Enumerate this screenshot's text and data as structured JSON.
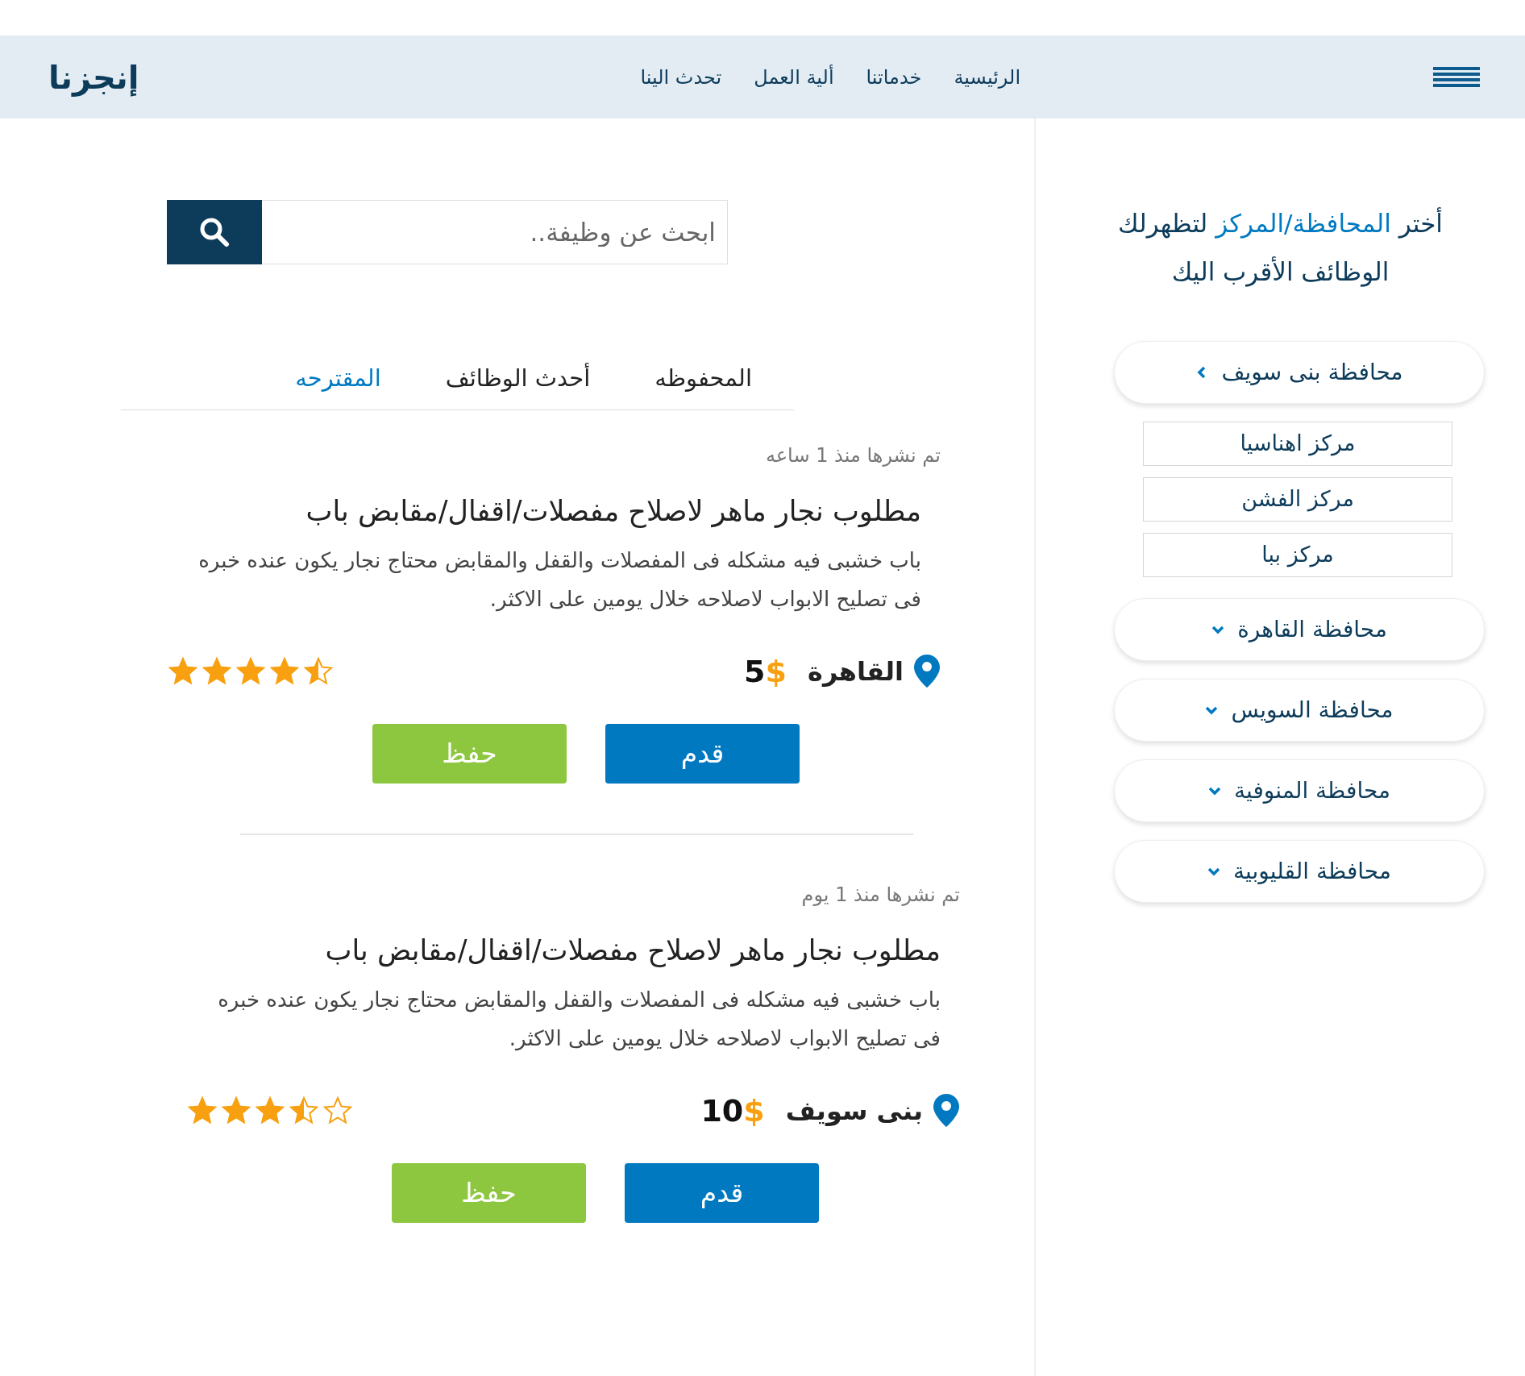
{
  "header": {
    "logo": "إنجزنا",
    "nav": [
      {
        "label": "الرئيسية"
      },
      {
        "label": "خدماتنا"
      },
      {
        "label": "ألية العمل"
      },
      {
        "label": "تحدث الينا"
      }
    ]
  },
  "sidebar": {
    "title": {
      "before": "أختر",
      "highlight": "المحافظة/المركز",
      "after": "لتظهرلك الوظائف الأقرب اليك"
    },
    "governorates": [
      {
        "label": "محافظة بنى سويف",
        "expanded": true,
        "children": [
          {
            "label": "مركز اهناسيا"
          },
          {
            "label": "مركز الفشن"
          },
          {
            "label": "مركز ببا"
          }
        ]
      },
      {
        "label": "محافظة القاهرة",
        "expanded": false
      },
      {
        "label": "محافظة السويس",
        "expanded": false
      },
      {
        "label": "محافظة المنوفية",
        "expanded": false
      },
      {
        "label": "محافظة القليوبية",
        "expanded": false
      }
    ]
  },
  "search": {
    "placeholder": "ابحث عن وظيفة.."
  },
  "tabs": [
    {
      "label": "المحفوظه",
      "selected": false
    },
    {
      "label": "أحدث الوظائف",
      "selected": false
    },
    {
      "label": "المقترحه",
      "selected": true
    }
  ],
  "jobs": [
    {
      "posted": "تم نشرها منذ 1 ساعه",
      "title": "مطلوب نجار ماهر لاصلاح مفصلات/اقفال/مقابض باب",
      "description": "باب خشبى فيه مشكله فى المفصلات والقفل والمقابض محتاج نجار يكون عنده خبره فى تصليح الابواب لاصلاحه خلال يومين على الاكثر.",
      "location": "القاهرة",
      "price": "5",
      "currency": "$",
      "stars": 4.5,
      "buttons": [
        {
          "label": "قدم",
          "kind": "apply"
        },
        {
          "label": "حفظ",
          "kind": "save"
        }
      ]
    },
    {
      "posted": "تم نشرها منذ 1 يوم",
      "title": "مطلوب نجار ماهر لاصلاح مفصلات/اقفال/مقابض باب",
      "description": "باب خشبى فيه مشكله فى المفصلات والقفل والمقابض محتاج نجار يكون عنده خبره فى تصليح الابواب لاصلاحه خلال يومين على الاكثر.",
      "location": "بنى سويف",
      "price": "10",
      "currency": "$",
      "stars": 3.5,
      "buttons": [
        {
          "label": "قدم",
          "kind": "apply"
        },
        {
          "label": "حفظ",
          "kind": "save"
        }
      ]
    }
  ]
}
